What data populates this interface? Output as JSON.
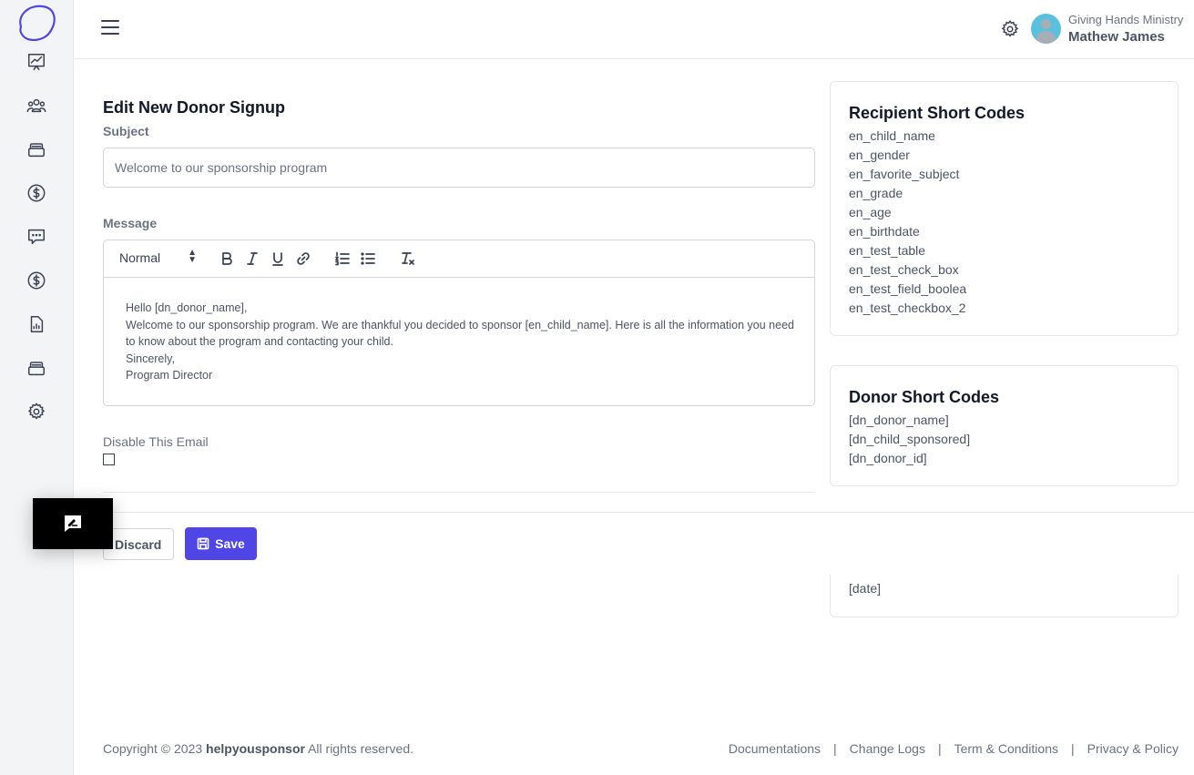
{
  "header": {
    "org_name": "Giving Hands Ministry",
    "user_name": "Mathew James"
  },
  "sidebar": {
    "items": [
      {
        "icon": "chart-icon"
      },
      {
        "icon": "users-icon"
      },
      {
        "icon": "box-icon"
      },
      {
        "icon": "dollar-icon"
      },
      {
        "icon": "message-icon"
      },
      {
        "icon": "dollar-icon"
      },
      {
        "icon": "report-icon"
      },
      {
        "icon": "box-icon"
      },
      {
        "icon": "gear-icon"
      }
    ]
  },
  "form": {
    "title": "Edit New Donor Signup",
    "subject_label": "Subject",
    "subject_value": "Welcome to our sponsorship program",
    "message_label": "Message",
    "format_select": "Normal",
    "message_lines": [
      "Hello [dn_donor_name],",
      "Welcome to our sponsorship program. We are thankful you decided to sponsor [en_child_name]. Here is all the information you need to know about the program and contacting your child.",
      "Sincerely,",
      "Program Director"
    ],
    "disable_label": "Disable This Email",
    "disable_checked": false,
    "discard_label": "Discard",
    "save_label": "Save"
  },
  "recipient_panel": {
    "title": "Recipient Short Codes",
    "codes": [
      "en_child_name",
      "en_gender",
      "en_favorite_subject",
      "en_grade",
      "en_age",
      "en_birthdate",
      "en_test_table",
      "en_test_check_box",
      "en_test_field_boolea",
      "en_test_checkbox_2"
    ]
  },
  "donor_panel": {
    "title": "Donor Short Codes",
    "codes": [
      "[dn_donor_name]",
      "[dn_child_sponsored]",
      "[dn_donor_id]"
    ]
  },
  "third_panel": {
    "codes": [
      "[date]"
    ]
  },
  "footer": {
    "copyright_prefix": "Copyright © 2023",
    "brand": "helpyousponsor",
    "copyright_suffix": "All rights reserved.",
    "links": [
      "Documentations",
      "Change Logs",
      "Term & Conditions",
      "Privacy & Policy"
    ]
  },
  "colors": {
    "accent": "#4f46e5",
    "sidebar_bg": "#f3f4f6",
    "avatar_bg": "#5bc0de"
  }
}
